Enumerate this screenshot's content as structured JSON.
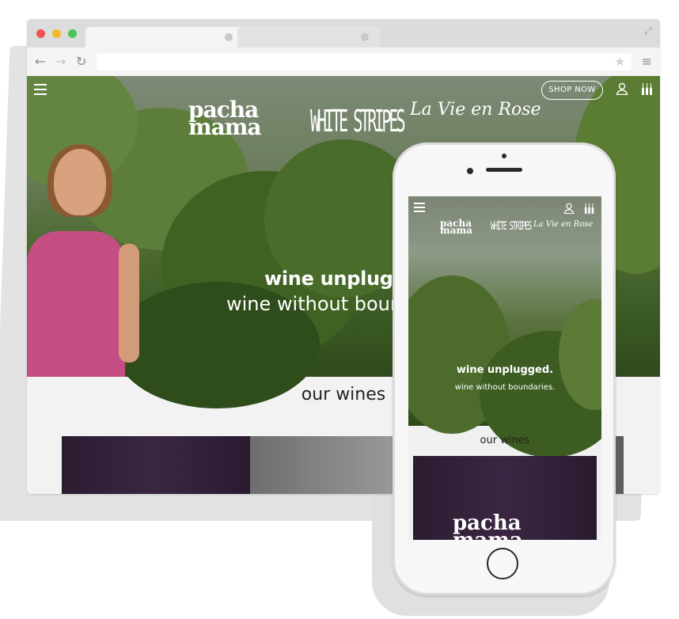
{
  "browser": {
    "window_controls": [
      "close",
      "minimize",
      "maximize"
    ],
    "address_bar": {
      "value": "",
      "placeholder": ""
    },
    "icons": [
      "back-arrow-icon",
      "forward-arrow-icon",
      "reload-icon",
      "bookmark-star-icon",
      "menu-icon",
      "fullscreen-icon"
    ]
  },
  "site": {
    "nav": {
      "shop_button_label": "SHOP NOW"
    },
    "brands": [
      "pacha mama",
      "WHITE STRIPES",
      "La Vie en Rose"
    ],
    "hero": {
      "tagline": "wine unplugged.",
      "subtagline": "wine without boundaries."
    },
    "section_title": "our wines"
  },
  "desktop_visible": {
    "tagline": "wine unplugg",
    "subtagline": "wine without boun"
  },
  "mobile": {
    "brands": [
      "pacha mama",
      "WHITE STRIPES",
      "La Vie en Rose"
    ],
    "hero": {
      "tagline": "wine unplugged.",
      "subtagline": "wine without boundaries."
    },
    "section_title": "our wines",
    "card_brand": "pacha mama"
  },
  "colors": {
    "accent_pink": "#c44e83",
    "foliage_green": "#3b5a23",
    "card_purple": "#2f2036"
  }
}
